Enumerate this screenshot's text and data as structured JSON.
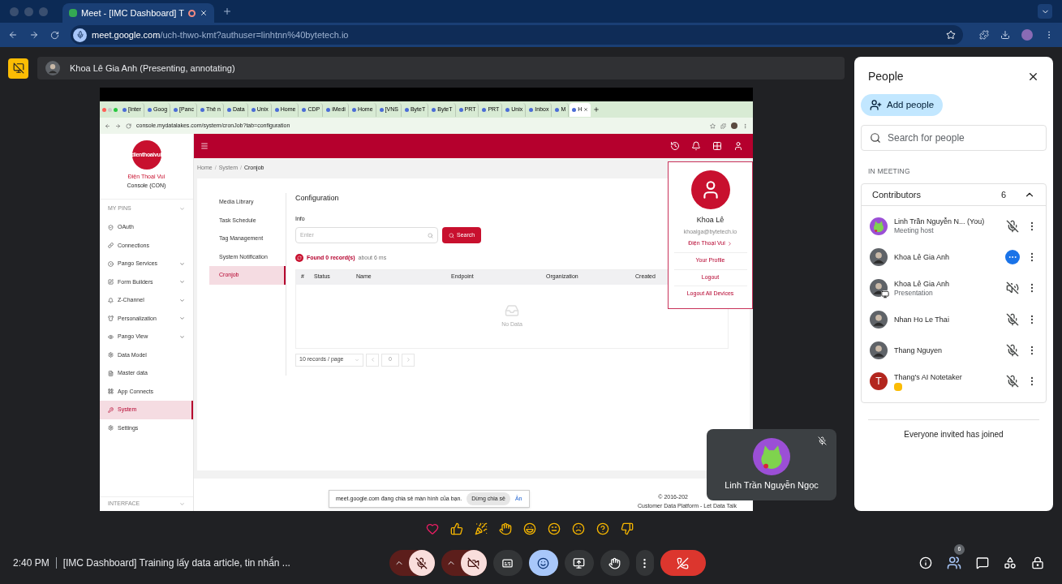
{
  "browser": {
    "tab_title": "Meet - [IMC Dashboard] T",
    "url_host": "meet.google.com",
    "url_path": "/uch-thwo-kmt?authuser=linhtnn%40bytetech.io"
  },
  "presenter_bar": {
    "label": "Khoa Lê Gia Anh (Presenting, annotating)"
  },
  "shared_screen": {
    "tabs": [
      {
        "label": "[Inter",
        "selected": false
      },
      {
        "label": "Goog",
        "selected": false
      },
      {
        "label": "[Panc",
        "selected": false
      },
      {
        "label": "Thẻ n",
        "selected": false
      },
      {
        "label": "Data",
        "selected": false
      },
      {
        "label": "Unix",
        "selected": false
      },
      {
        "label": "Home",
        "selected": false
      },
      {
        "label": "CDP",
        "selected": false
      },
      {
        "label": "iMedi",
        "selected": false
      },
      {
        "label": "Home",
        "selected": false
      },
      {
        "label": "[VNS",
        "selected": false
      },
      {
        "label": "ByteT",
        "selected": false
      },
      {
        "label": "ByteT",
        "selected": false
      },
      {
        "label": "PRT",
        "selected": false
      },
      {
        "label": "PRT",
        "selected": false
      },
      {
        "label": "Unix",
        "selected": false
      },
      {
        "label": "Inbox",
        "selected": false
      },
      {
        "label": "M",
        "selected": false
      },
      {
        "label": "H",
        "selected": true
      }
    ],
    "url": "console.mydatalakes.com/system/cronJob?tab=configuration",
    "brand": {
      "logo_text": "dienthoaivui",
      "name": "Điện Thoại Vui",
      "subtitle": "Console (CON)"
    },
    "pins_label": "MY PINS",
    "nav": [
      {
        "label": "OAuth",
        "expandable": false,
        "selected": false
      },
      {
        "label": "Connections",
        "expandable": false,
        "selected": false
      },
      {
        "label": "Pango Services",
        "expandable": true,
        "selected": false
      },
      {
        "label": "Form Builders",
        "expandable": true,
        "selected": false
      },
      {
        "label": "Z-Channel",
        "expandable": true,
        "selected": false
      },
      {
        "label": "Personalization",
        "expandable": true,
        "selected": false
      },
      {
        "label": "Pango View",
        "expandable": true,
        "selected": false
      },
      {
        "label": "Data Model",
        "expandable": false,
        "selected": false
      },
      {
        "label": "Master data",
        "expandable": false,
        "selected": false
      },
      {
        "label": "App Connects",
        "expandable": false,
        "selected": false
      },
      {
        "label": "System",
        "expandable": false,
        "selected": true
      },
      {
        "label": "Settings",
        "expandable": false,
        "selected": false
      }
    ],
    "interface_label": "INTERFACE",
    "breadcrumb": [
      "Home",
      "System",
      "Cronjob"
    ],
    "breadcrumb_separator": "/",
    "subnav": [
      {
        "label": "Media Library",
        "selected": false
      },
      {
        "label": "Task Schedule",
        "selected": false
      },
      {
        "label": "Tag Management",
        "selected": false
      },
      {
        "label": "System Notification",
        "selected": false
      },
      {
        "label": "Cronjob",
        "selected": true
      }
    ],
    "heading": "Configuration",
    "info_label": "Info",
    "search_placeholder": "Enter",
    "search_button": "Search",
    "result": "Found 0 record(s)",
    "result_time": "about 6 ms",
    "columns": [
      "#",
      "Status",
      "Name",
      "Endpoint",
      "Organization",
      "Created"
    ],
    "empty": "No Data",
    "page_size": "10 records / page",
    "page": "0",
    "footer": [
      "© 2016-202",
      "Customer Data Platform - Let Data Talk"
    ],
    "profile_menu": {
      "name": "Khoa Lê",
      "email": "khoalga@bytetech.io",
      "org": "Điện Thoại Vui",
      "items": [
        "Your Profile",
        "Logout",
        "Logout All Devices"
      ]
    },
    "share_notice": {
      "text": "meet.google.com đang chia sẻ màn hình của bạn.",
      "stop": "Dừng chia sẻ",
      "hide": "Ẩn"
    }
  },
  "self_tile": {
    "name": "Linh Trần Nguyễn Ngọc",
    "muted": true
  },
  "people": {
    "title": "People",
    "add": "Add people",
    "search_placeholder": "Search for people",
    "section": "IN MEETING",
    "group": "Contributors",
    "count": "6",
    "expanded": true,
    "members": [
      {
        "name": "Linh Trần Nguyễn N... (You)",
        "subtitle": "Meeting host",
        "avatar": {
          "kind": "cartoon"
        },
        "audio": {
          "kind": "muted"
        },
        "presenting": false,
        "ai_badge": false
      },
      {
        "name": "Khoa Lê Gia Anh",
        "avatar": {
          "kind": "photo"
        },
        "audio": {
          "kind": "speaking"
        },
        "presenting": false,
        "ai_badge": false
      },
      {
        "name": "Khoa Lê Gia Anh",
        "subtitle": "Presentation",
        "avatar": {
          "kind": "photo"
        },
        "audio": {
          "kind": "sound_off"
        },
        "presenting": true,
        "ai_badge": false
      },
      {
        "name": "Nhan Ho Le Thai",
        "avatar": {
          "kind": "photo"
        },
        "audio": {
          "kind": "muted"
        },
        "presenting": false,
        "ai_badge": false
      },
      {
        "name": "Thang Nguyen",
        "avatar": {
          "kind": "photo"
        },
        "audio": {
          "kind": "muted"
        },
        "presenting": false,
        "ai_badge": false
      },
      {
        "name": "Thang's AI Notetaker",
        "avatar": {
          "kind": "letter",
          "letter": "T"
        },
        "audio": {
          "kind": "muted"
        },
        "presenting": false,
        "ai_badge": true
      }
    ],
    "footer": "Everyone invited has joined"
  },
  "bottom": {
    "time": "2:40 PM",
    "meeting_title": "[IMC Dashboard] Training lấy data article, tin nhắn ...",
    "mic_on": false,
    "camera_on": false,
    "captions_on": false,
    "reactions_open": true,
    "hand_raised": false,
    "people_open": true,
    "people_count": "6"
  }
}
